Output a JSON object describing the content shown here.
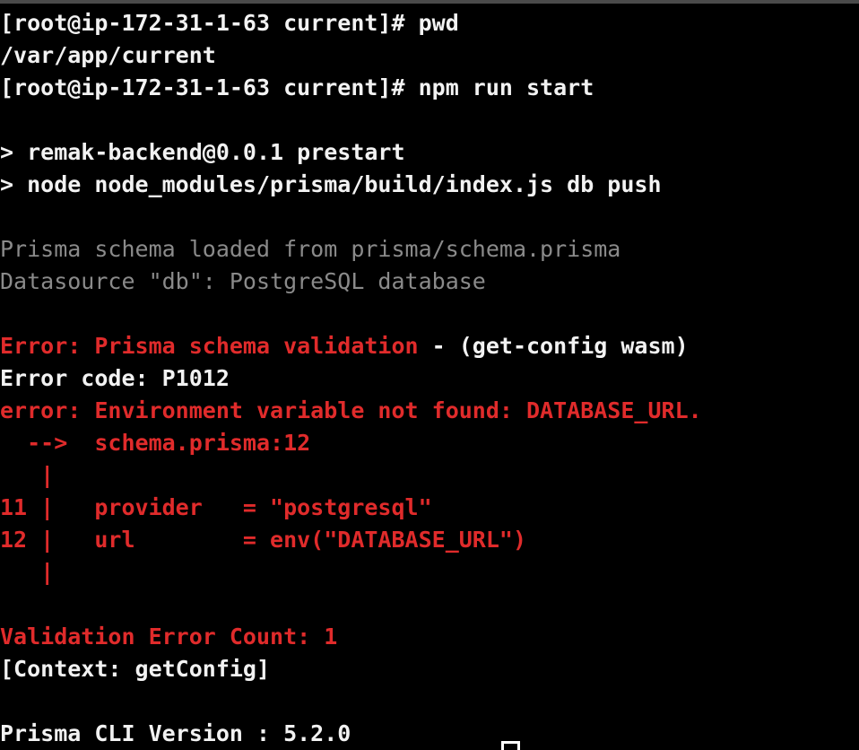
{
  "terminal": {
    "background_color": "#000000",
    "foreground_color": "#f2f2f2",
    "dim_color": "#8a8a8a",
    "error_color": "#e02b2b",
    "cursor": {
      "name": "block-cursor",
      "visible": true
    },
    "lines": [
      {
        "id": "line-1",
        "name": "shell-prompt-pwd",
        "segments": [
          {
            "text": "[root@ip-172-31-1-63 current]# pwd",
            "style": "fg-white bold"
          }
        ]
      },
      {
        "id": "line-2",
        "name": "pwd-output",
        "segments": [
          {
            "text": "/var/app/current",
            "style": "fg-white bold"
          }
        ]
      },
      {
        "id": "line-3",
        "name": "shell-prompt-npm-run-start",
        "segments": [
          {
            "text": "[root@ip-172-31-1-63 current]# npm run start",
            "style": "fg-white bold"
          }
        ]
      },
      {
        "id": "line-4",
        "name": "blank-line",
        "segments": [
          {
            "text": "",
            "style": "fg-white"
          }
        ]
      },
      {
        "id": "line-5",
        "name": "npm-script-header-prestart",
        "segments": [
          {
            "text": "> remak-backend@0.0.1 prestart",
            "style": "fg-white bold"
          }
        ]
      },
      {
        "id": "line-6",
        "name": "npm-script-command-prestart",
        "segments": [
          {
            "text": "> node node_modules/prisma/build/index.js db push",
            "style": "fg-white bold"
          }
        ]
      },
      {
        "id": "line-7",
        "name": "blank-line",
        "segments": [
          {
            "text": "",
            "style": "fg-white"
          }
        ]
      },
      {
        "id": "line-8",
        "name": "prisma-schema-loaded-message",
        "segments": [
          {
            "text": "Prisma schema loaded from prisma/schema.prisma",
            "style": "fg-dim"
          }
        ]
      },
      {
        "id": "line-9",
        "name": "datasource-message",
        "segments": [
          {
            "text": "Datasource \"db\": PostgreSQL database",
            "style": "fg-dim"
          }
        ]
      },
      {
        "id": "line-10",
        "name": "blank-line",
        "segments": [
          {
            "text": "",
            "style": "fg-white"
          }
        ]
      },
      {
        "id": "line-11",
        "name": "error-headline-schema-validation",
        "segments": [
          {
            "text": "Error: Prisma schema validation",
            "style": "fg-red bold"
          },
          {
            "text": " - (get-config wasm)",
            "style": "fg-white bold"
          }
        ]
      },
      {
        "id": "line-12",
        "name": "error-code-line",
        "segments": [
          {
            "text": "Error code: P1012",
            "style": "fg-white bold"
          }
        ]
      },
      {
        "id": "line-13",
        "name": "error-detail-env-var-not-found",
        "segments": [
          {
            "text": "error: Environment variable not found: DATABASE_URL.",
            "style": "fg-red bold"
          }
        ]
      },
      {
        "id": "line-14",
        "name": "error-location-pointer",
        "segments": [
          {
            "text": "  -->  schema.prisma:12",
            "style": "fg-red bold"
          }
        ]
      },
      {
        "id": "line-15",
        "name": "code-frame-gutter-top",
        "segments": [
          {
            "text": "   |",
            "style": "fg-red bold"
          }
        ]
      },
      {
        "id": "line-16",
        "name": "code-frame-line-11",
        "segments": [
          {
            "text": "11 |   provider   = \"postgresql\"",
            "style": "fg-red bold"
          }
        ]
      },
      {
        "id": "line-17",
        "name": "code-frame-line-12",
        "segments": [
          {
            "text": "12 |   url        = env(\"DATABASE_URL\")",
            "style": "fg-red bold"
          }
        ]
      },
      {
        "id": "line-18",
        "name": "code-frame-gutter-bottom",
        "segments": [
          {
            "text": "   |",
            "style": "fg-red bold"
          }
        ]
      },
      {
        "id": "line-19",
        "name": "blank-line",
        "segments": [
          {
            "text": "",
            "style": "fg-white"
          }
        ]
      },
      {
        "id": "line-20",
        "name": "validation-error-count",
        "segments": [
          {
            "text": "Validation Error Count: 1",
            "style": "fg-red bold"
          }
        ]
      },
      {
        "id": "line-21",
        "name": "context-line",
        "segments": [
          {
            "text": "[Context: getConfig]",
            "style": "fg-white bold"
          }
        ]
      },
      {
        "id": "line-22",
        "name": "blank-line",
        "segments": [
          {
            "text": "",
            "style": "fg-white"
          }
        ]
      },
      {
        "id": "line-23",
        "name": "prisma-cli-version",
        "segments": [
          {
            "text": "Prisma CLI Version : 5.2.0",
            "style": "fg-white bold"
          }
        ]
      }
    ]
  }
}
